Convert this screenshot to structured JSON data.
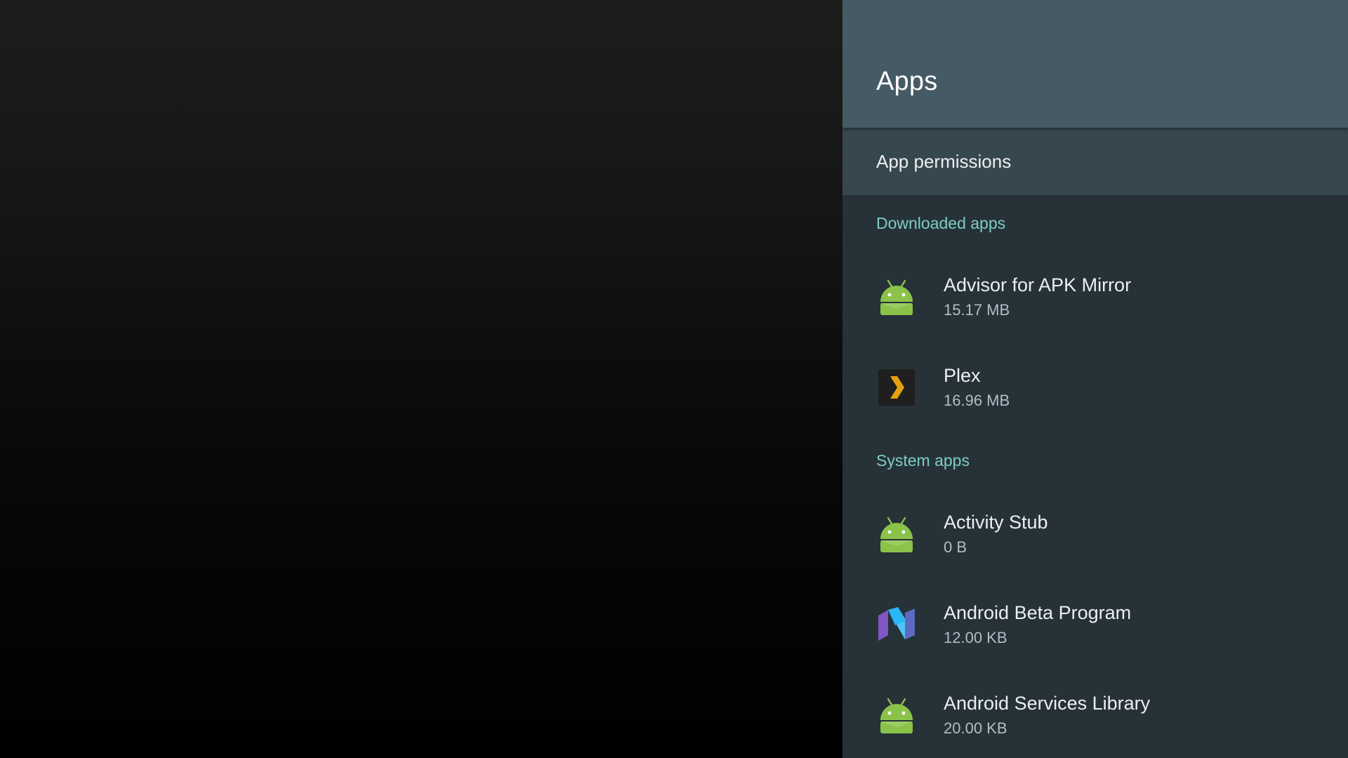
{
  "panel": {
    "title": "Apps",
    "permissions_label": "App permissions"
  },
  "sections": {
    "downloaded": {
      "header": "Downloaded apps",
      "apps": [
        {
          "name": "Advisor for APK Mirror",
          "size": "15.17 MB",
          "icon": "android-robot-icon"
        },
        {
          "name": "Plex",
          "size": "16.96 MB",
          "icon": "plex-chevron-icon"
        }
      ]
    },
    "system": {
      "header": "System apps",
      "apps": [
        {
          "name": "Activity Stub",
          "size": "0 B",
          "icon": "android-robot-icon"
        },
        {
          "name": "Android Beta Program",
          "size": "12.00 KB",
          "icon": "android-n-icon"
        },
        {
          "name": "Android Services Library",
          "size": "20.00 KB",
          "icon": "android-robot-icon"
        }
      ]
    }
  },
  "colors": {
    "header_bg": "#455a64",
    "panel_bg": "#263238",
    "selected_row_bg": "#37474f",
    "section_accent": "#80cbc4",
    "android_green": "#8bc34a",
    "plex_orange": "#e5a00d"
  }
}
